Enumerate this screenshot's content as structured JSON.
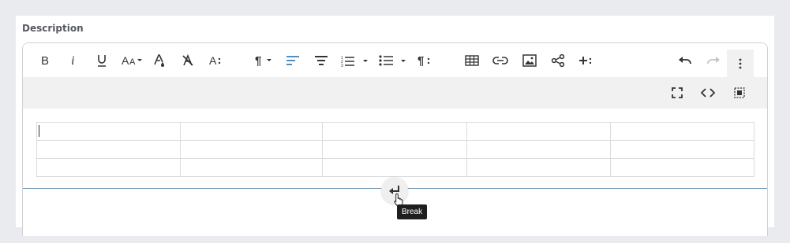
{
  "field": {
    "label": "Description"
  },
  "toolbar": {
    "buttons": [
      {
        "name": "bold-button",
        "icon": "bold-icon",
        "glyph": "B"
      },
      {
        "name": "italic-button",
        "icon": "italic-icon",
        "glyph": "i"
      },
      {
        "name": "underline-button",
        "icon": "underline-icon",
        "glyph": "U"
      },
      {
        "name": "font-size-button",
        "icon": "font-size-icon",
        "glyph": "AA"
      },
      {
        "name": "text-color-button",
        "icon": "text-color-icon"
      },
      {
        "name": "clear-format-button",
        "icon": "clear-format-icon"
      },
      {
        "name": "more-text-button",
        "icon": "more-text-icon",
        "glyph": "A⁝"
      },
      {
        "name": "paragraph-format-button",
        "icon": "pilcrow-icon",
        "glyph": "¶"
      },
      {
        "name": "align-left-button",
        "icon": "align-left-icon",
        "active": true
      },
      {
        "name": "align-center-button",
        "icon": "align-center-icon"
      },
      {
        "name": "ordered-list-button",
        "icon": "ordered-list-icon"
      },
      {
        "name": "unordered-list-button",
        "icon": "unordered-list-icon"
      },
      {
        "name": "more-paragraph-button",
        "icon": "more-paragraph-icon",
        "glyph": "¶⁝"
      },
      {
        "name": "insert-table-button",
        "icon": "table-icon"
      },
      {
        "name": "insert-link-button",
        "icon": "link-icon"
      },
      {
        "name": "insert-image-button",
        "icon": "image-icon"
      },
      {
        "name": "share-button",
        "icon": "share-icon"
      },
      {
        "name": "more-insert-button",
        "icon": "more-insert-icon",
        "glyph": "+⁝"
      },
      {
        "name": "undo-button",
        "icon": "undo-icon"
      },
      {
        "name": "redo-button",
        "icon": "redo-icon",
        "disabled": true
      },
      {
        "name": "more-misc-button",
        "icon": "vertical-dots-icon"
      }
    ],
    "secondary": [
      {
        "name": "fullscreen-button",
        "icon": "fullscreen-icon"
      },
      {
        "name": "code-view-button",
        "icon": "code-icon"
      },
      {
        "name": "select-all-button",
        "icon": "select-all-icon"
      }
    ]
  },
  "colors": {
    "accent": "#3f92d6",
    "icon": "#333333",
    "disabled": "#c4c4c4",
    "toolbar_bg": "#f1f1f1"
  },
  "table": {
    "rows": 3,
    "cols": 5
  },
  "break": {
    "icon": "enter-arrow-icon",
    "tooltip": "Break"
  }
}
